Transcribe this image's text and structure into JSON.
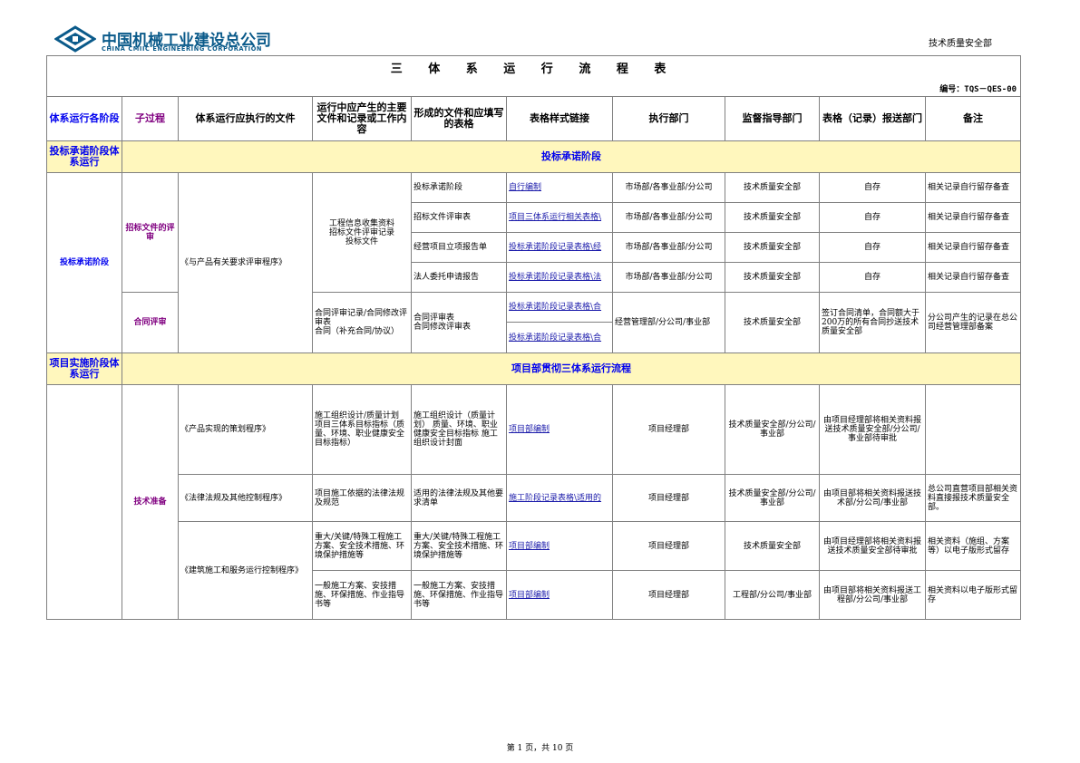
{
  "header": {
    "company_cn": "中国机械工业建设总公司",
    "company_en": "CHINA CMIIC ENGINEERING CORPORATION",
    "department": "技术质量安全部",
    "brand_color": "#0a5a8a"
  },
  "doc": {
    "title": "三 体 系 运 行 流 程 表",
    "code": "编号：TQS－QES-00"
  },
  "columns": {
    "c1": "体系运行各阶段",
    "c2": "子过程",
    "c3": "体系运行应执行的文件",
    "c4": "运行中应产生的主要文件和记录或工作内容",
    "c5": "形成的文件和应填写的表格",
    "c6": "表格样式链接",
    "c7": "执行部门",
    "c8": "监督指导部门",
    "c9": "表格（记录）报送部门",
    "c10": "备注"
  },
  "stage1": {
    "label": "投标承诺阶段体系运行",
    "banner": "投标承诺阶段",
    "left": "投标承诺阶段",
    "sub1": "招标文件的评审",
    "sub2": "合同评审",
    "program": "《与产品有关要求评审程序》",
    "work1": "工程信息收集资料\n招标文件评审记录\n投标文件",
    "rows": [
      {
        "form": "投标承诺阶段",
        "link": "自行编制",
        "exec": "市场部/各事业部/分公司",
        "sup": "技术质量安全部",
        "report": "自存",
        "note": "相关记录自行留存备查"
      },
      {
        "form": "招标文件评审表",
        "link": "项目三体系运行相关表格\\",
        "exec": "市场部/各事业部/分公司",
        "sup": "技术质量安全部",
        "report": "自存",
        "note": "相关记录自行留存备查"
      },
      {
        "form": "经营项目立项报告单",
        "link": "投标承诺阶段记录表格\\经",
        "exec": "市场部/各事业部/分公司",
        "sup": "技术质量安全部",
        "report": "自存",
        "note": "相关记录自行留存备查"
      },
      {
        "form": "法人委托申请报告",
        "link": "投标承诺阶段记录表格\\法",
        "exec": "市场部/各事业部/分公司",
        "sup": "技术质量安全部",
        "report": "自存",
        "note": "相关记录自行留存备查"
      }
    ],
    "contract": {
      "work": "合同评审记录/合同修改评审表\n合同（补充合同/协议）",
      "form": "合同评审表\n合同修改评审表",
      "link1": "投标承诺阶段记录表格\\合",
      "link2": "投标承诺阶段记录表格\\合",
      "exec": "经营管理部/分公司/事业部",
      "sup": "技术质量安全部",
      "report": "签订合同清单，合同额大于200万的所有合同抄送技术质量安全部",
      "note": "分公司产生的记录在总公司经营管理部备案"
    }
  },
  "stage2": {
    "label": "项目实施阶段体系运行",
    "banner": "项目部贯彻三体系运行流程",
    "sub": "技术准备",
    "rows": [
      {
        "program": "《产品实现的策划程序》",
        "work": "施工组织设计/质量计划\n项目三体系目标指标（质量、环境、职业健康安全目标指标）",
        "form": "施工组织设计（质量计划）\n质量、环境、职业健康安全目标指标\n施工组织设计封面",
        "link": "项目部编制",
        "exec": "项目经理部",
        "sup": "技术质量安全部/分公司/事业部",
        "report": "由项目经理部将相关资料报送技术质量安全部/分公司/事业部待审批",
        "note": ""
      },
      {
        "program": "《法律法规及其他控制程序》",
        "work": "项目施工依据的法律法规及规范",
        "form": "适用的法律法规及其他要求清单",
        "link": "施工阶段记录表格\\适用的",
        "exec": "项目经理部",
        "sup": "技术质量安全部/分公司/事业部",
        "report": "由项目部将相关资料报送技术部/分公司/事业部",
        "note": "总公司直营项目部相关资料直接报技术质量安全部。"
      },
      {
        "program": "《建筑施工和服务运行控制程序》",
        "work": "重大/关键/特殊工程施工方案、安全技术措施、环境保护措施等",
        "form": "重大/关键/特殊工程施工方案、安全技术措施、环境保护措施等",
        "link": "项目部编制",
        "exec": "项目经理部",
        "sup": "技术质量安全部",
        "report": "由项目经理部将相关资料报送技术质量安全部待审批",
        "note": "相关资料（施组、方案等）以电子版形式留存"
      },
      {
        "program": "",
        "work": "一般施工方案、安技措施、环保措施、作业指导书等",
        "form": "一般施工方案、安技措施、环保措施、作业指导书等",
        "link": "项目部编制",
        "exec": "项目经理部",
        "sup": "工程部/分公司/事业部",
        "report": "由项目部将相关资料报送工程部/分公司/事业部",
        "note": "相关资料以电子版形式留存"
      }
    ]
  },
  "footer": "第 1 页，共 10 页"
}
